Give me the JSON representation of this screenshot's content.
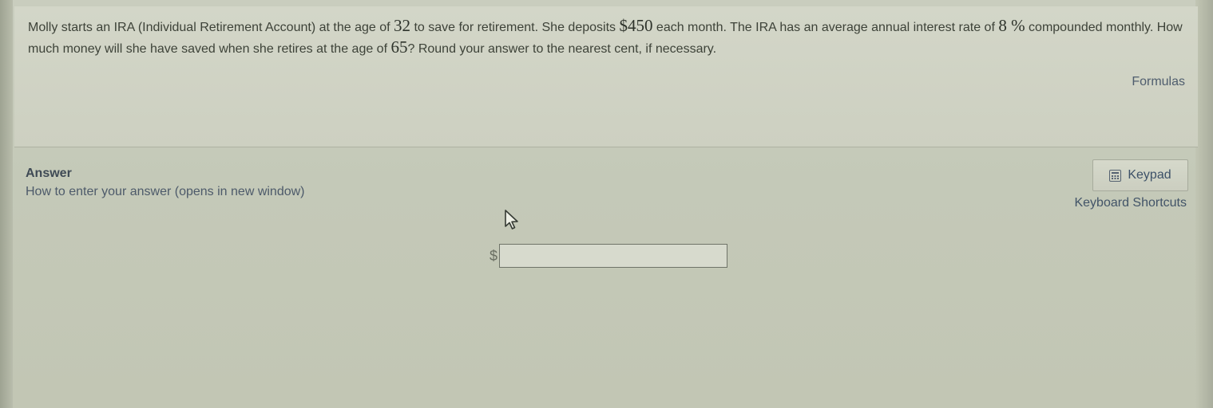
{
  "question": {
    "part1": "Molly starts an IRA (Individual Retirement Account) at the age of ",
    "age_start": "32",
    "part2": " to save for retirement. She deposits ",
    "deposit": "$450",
    "part3": " each month. The IRA has an average annual interest rate of ",
    "rate": "8 %",
    "part4": " compounded monthly. How much money will she have saved when she retires at the age of ",
    "age_end": "65",
    "part5": "? Round your answer to the nearest cent, if necessary."
  },
  "formulas_label": "Formulas",
  "answer": {
    "heading": "Answer",
    "howto_label": "How to enter your answer (opens in new window)",
    "keypad_label": "Keypad",
    "shortcuts_label": "Keyboard Shortcuts",
    "currency_symbol": "$",
    "input_value": "",
    "input_placeholder": ""
  },
  "icons": {
    "keypad": "keypad-icon",
    "cursor": "mouse-pointer-icon"
  }
}
